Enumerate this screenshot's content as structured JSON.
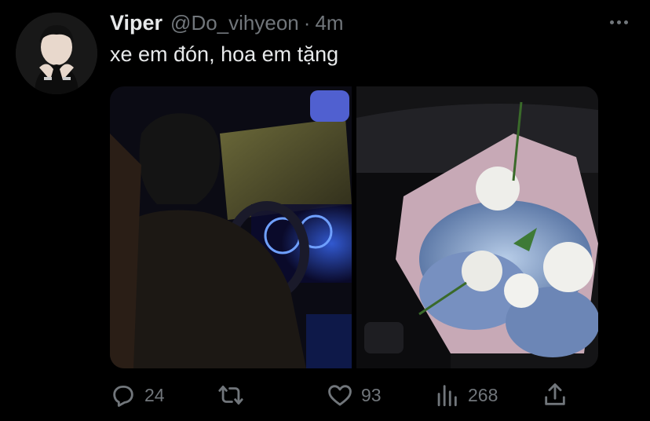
{
  "tweet": {
    "display_name": "Viper",
    "handle": "@Do_vihyeon",
    "separator": "·",
    "time": "4m",
    "text": "xe em đón, hoa em tặng"
  },
  "media": [
    {
      "description": "man-driving-car-at-night",
      "icon": "photo"
    },
    {
      "description": "flower-bouquet-in-car",
      "icon": "photo"
    }
  ],
  "actions": {
    "reply_count": "24",
    "retweet_count": "",
    "like_count": "93",
    "view_count": "268"
  },
  "icons": [
    "more-icon",
    "reply-icon",
    "retweet-icon",
    "like-icon",
    "views-icon",
    "share-icon"
  ],
  "colors": {
    "background": "#000000",
    "primary_text": "#e7e9ea",
    "secondary_text": "#71767b"
  }
}
